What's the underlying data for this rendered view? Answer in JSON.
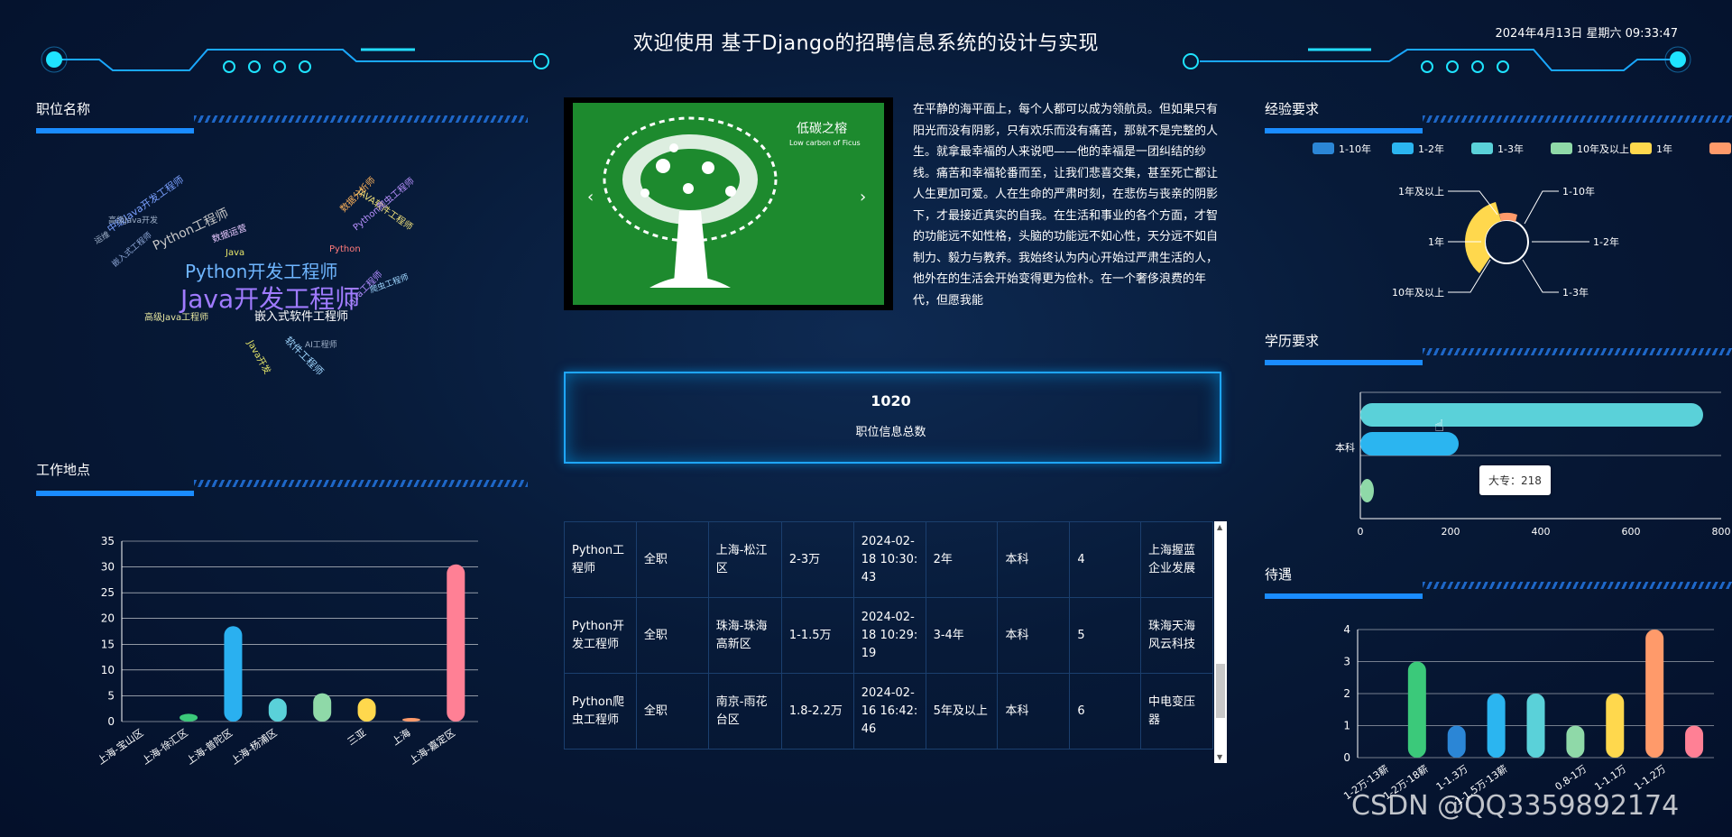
{
  "header": {
    "title": "欢迎使用 基于Django的招聘信息系统的设计与实现",
    "datetime": "2024年4月13日 星期六 09:33:47"
  },
  "panels": {
    "position_names": "职位名称",
    "work_location": "工作地点",
    "experience": "经验要求",
    "education": "学历要求",
    "benefits": "待遇"
  },
  "wordcloud": [
    {
      "text": "Java开发工程师",
      "color": "#a07bff"
    },
    {
      "text": "Python开发工程师",
      "color": "#6fb6ff"
    },
    {
      "text": "Python工程师",
      "color": "#c8c8c8"
    },
    {
      "text": "中级Java开发工程师",
      "color": "#7aa0ff"
    },
    {
      "text": "嵌入式软件工程师",
      "color": "#ffffff"
    },
    {
      "text": "高级Java工程师",
      "color": "#e6e6a0"
    },
    {
      "text": "JAVA软件工程师",
      "color": "#f2e27a"
    },
    {
      "text": "数据分析师",
      "color": "#ffb35a"
    },
    {
      "text": "Python",
      "color": "#ff7a7a"
    },
    {
      "text": "Java",
      "color": "#e6e66a"
    },
    {
      "text": "Java工程师",
      "color": "#b18cff"
    },
    {
      "text": "软件工程师",
      "color": "#9fd6ff"
    },
    {
      "text": "Java开发",
      "color": "#e6e66a"
    },
    {
      "text": "AI工程师",
      "color": "#9fb0c8"
    },
    {
      "text": "数据运营",
      "color": "#e6c8ff"
    },
    {
      "text": "Python爬虫工程师",
      "color": "#b891ff"
    },
    {
      "text": "嵌入式工程师",
      "color": "#8fa8d8"
    },
    {
      "text": "高级Java开发",
      "color": "#9fb0c8"
    },
    {
      "text": "爬虫工程师",
      "color": "#9fd6ff"
    },
    {
      "text": "运维",
      "color": "#9fb0c8"
    }
  ],
  "carousel": {
    "image_title": "低碳之榕",
    "image_subtitle": "Low carbon of Ficus",
    "prev": "‹",
    "next": "›"
  },
  "intro_text": "在平静的海平面上，每个人都可以成为领航员。但如果只有阳光而没有阴影，只有欢乐而没有痛苦，那就不是完整的人生。就拿最幸福的人来说吧——他的幸福是一团纠结的纱线。痛苦和幸福轮番而至，让我们悲喜交集，甚至死亡都让人生更加可爱。人在生命的严肃时刻，在悲伤与丧亲的阴影下，才最接近真实的自我。在生活和事业的各个方面，才智的功能远不如性格，头脑的功能远不如心性，天分远不如自制力、毅力与教养。我始终认为内心开始过严肃生活的人，他外在的生活会开始变得更为俭朴。在一个奢侈浪费的年代，但愿我能",
  "total": {
    "value": "1020",
    "label": "职位信息总数"
  },
  "jobs_table": [
    [
      "Python工程师",
      "全职",
      "上海-松江区",
      "2-3万",
      "2024-02-18 10:30:43",
      "2年",
      "本科",
      "4",
      "上海握蓝企业发展"
    ],
    [
      "Python开发工程师",
      "全职",
      "珠海-珠海高新区",
      "1-1.5万",
      "2024-02-18 10:29:19",
      "3-4年",
      "本科",
      "5",
      "珠海天海风云科技"
    ],
    [
      "Python爬虫工程师",
      "全职",
      "南京-雨花台区",
      "1.8-2.2万",
      "2024-02-16 16:42:46",
      "5年及以上",
      "本科",
      "6",
      "中电变压器"
    ]
  ],
  "tooltip": "大专：218",
  "watermark": "CSDN @QQ3359892174",
  "chart_data": [
    {
      "type": "bar",
      "name": "work_location",
      "categories": [
        "上海-宝山区",
        "上海-徐汇区",
        "上海-普陀区",
        "上海-杨浦区",
        "",
        "三亚",
        "上海",
        "上海-嘉定区"
      ],
      "values": [
        0,
        1.5,
        18.5,
        4.5,
        5.5,
        4.5,
        0.7,
        30.5
      ],
      "colors": [
        "#3ba0ff",
        "#3bc97a",
        "#2ab0f0",
        "#5ad1d9",
        "#8fd9a8",
        "#ffd84d",
        "#ff9a6a",
        "#ff8095"
      ],
      "ylim": [
        0,
        35
      ],
      "yticks": [
        0,
        5,
        10,
        15,
        20,
        25,
        30,
        35
      ],
      "grid": true
    },
    {
      "type": "pie",
      "name": "experience",
      "legend": [
        "1-10年",
        "1-2年",
        "1-3年",
        "10年及以上",
        "1年",
        "1年及以上"
      ],
      "colors": [
        "#2b86d6",
        "#2bb5f0",
        "#5ad1d9",
        "#8fd9a8",
        "#ffd84d",
        "#ff9a6a"
      ],
      "labels": [
        "1年及以上",
        "1-10年",
        "1年",
        "1-2年",
        "10年及以上",
        "1-3年"
      ],
      "legend_position": "top"
    },
    {
      "type": "bar",
      "name": "education",
      "orientation": "horizontal",
      "categories": [
        "本科",
        "大专"
      ],
      "values": [
        760,
        218
      ],
      "extra_value": 30,
      "colors": [
        "#5ad1d9",
        "#2bb5f0",
        "#8fd9a8"
      ],
      "xlim": [
        0,
        800
      ],
      "xticks": [
        0,
        200,
        400,
        600,
        800
      ],
      "grid": true
    },
    {
      "type": "bar",
      "name": "benefits",
      "categories": [
        "1-2万·13薪",
        "1-2万·18薪",
        "1-1.3万",
        "1-1.5万·13薪",
        "",
        "0.8-1万",
        "1-1.1万",
        "1-1.2万"
      ],
      "values": [
        0,
        3,
        1,
        2,
        2,
        1,
        2,
        4,
        1
      ],
      "colors": [
        "#3ba0ff",
        "#3bc97a",
        "#2b86d6",
        "#2bb5f0",
        "#5ad1d9",
        "#8fd9a8",
        "#ffd84d",
        "#ff9a6a",
        "#ff8095"
      ],
      "ylim": [
        0,
        4
      ],
      "yticks": [
        0,
        1,
        2,
        3,
        4
      ],
      "grid": true
    }
  ]
}
